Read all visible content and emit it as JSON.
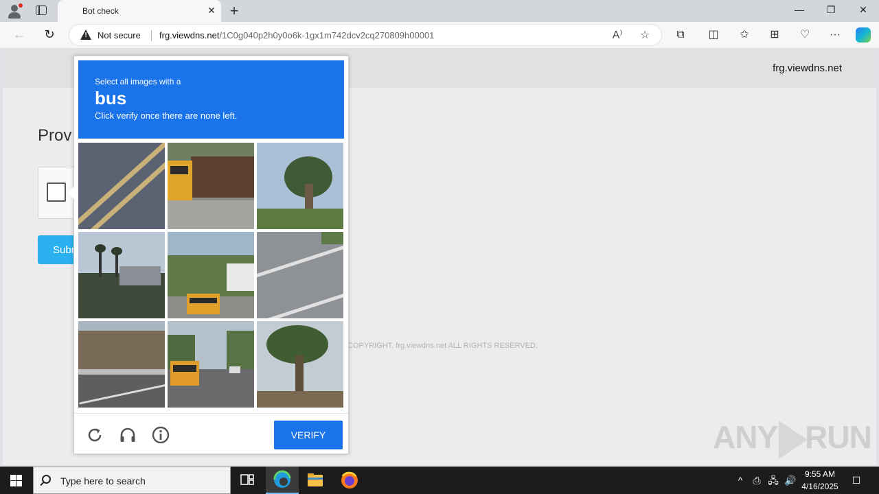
{
  "browser": {
    "tab_title": "Bot check",
    "not_secure_label": "Not secure",
    "url_host": "frg.viewdns.net",
    "url_path": "/1C0g040p2h0y0o6k-1gx1m742dcv2cq270809h00001",
    "icons": [
      "profile-icon",
      "tab-actions-icon",
      "close-icon",
      "plus-icon",
      "minimize-icon",
      "restore-icon",
      "back-icon",
      "refresh-icon",
      "warning-icon",
      "read-aloud-icon",
      "favorite-icon",
      "extensions-icon",
      "split-screen-icon",
      "favorites-icon",
      "collections-icon",
      "browser-essentials-icon",
      "more-icon",
      "copilot-icon"
    ]
  },
  "page": {
    "site_name": "frg.viewdns.net",
    "title_partial": "Prov",
    "submit_partial": "Subm",
    "copyright": "COPYRIGHT. frg.viewdns.net ALL RIGHTS RESERVED.",
    "watermark_left": "ANY",
    "watermark_right": "RUN"
  },
  "captcha": {
    "prompt_pre": "Select all images with a",
    "prompt_word": "bus",
    "prompt_post": "Click verify once there are none left.",
    "verify_label": "VERIFY",
    "accent": "#1a73e8",
    "tiles": [
      "road-markings",
      "school-bus-by-fence",
      "palm-tree",
      "palm-trees-hillside",
      "school-bus-street",
      "crosswalk",
      "dirt-hill-guardrail",
      "buses-on-road",
      "tall-palm-tree"
    ],
    "footer_icons": [
      "reload-icon",
      "audio-icon",
      "info-icon"
    ]
  },
  "taskbar": {
    "search_placeholder": "Type here to search",
    "time": "9:55 AM",
    "date": "4/16/2025"
  }
}
